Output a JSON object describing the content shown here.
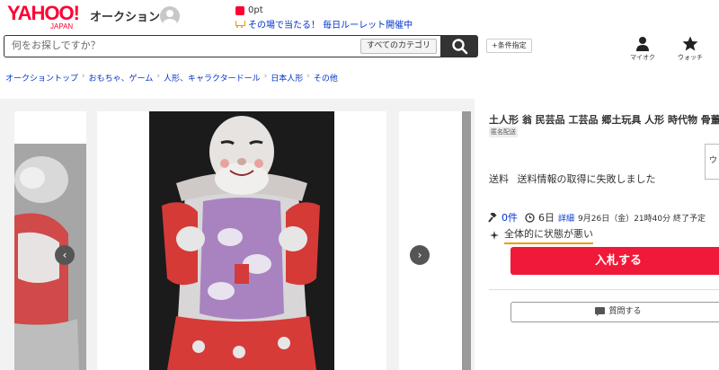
{
  "header": {
    "logo_text": "YAHOO!",
    "logo_sub": "JAPAN",
    "service_name": "オークション",
    "points": "0pt",
    "promo": "その場で当たる！ 毎日ルーレット開催中",
    "search_placeholder": "何をお探しですか？",
    "category_select": "すべてのカテゴリ",
    "condition_button": "+条件指定",
    "my_auction_label": "マイオク",
    "watch_label": "ウォッチ",
    "icons": [
      "search-icon",
      "person-icon",
      "star-icon",
      "cart-icon"
    ],
    "brand_color": "#ff0033"
  },
  "breadcrumb": [
    "オークショントップ",
    "おもちゃ、ゲーム",
    "人形、キャラクタードール",
    "日本人形",
    "その他"
  ],
  "gallery": {
    "prev_icon": "‹",
    "next_icon": "›"
  },
  "item": {
    "title": "土人形 翁 民芸品 工芸品 郷土玩具 人形 時代物 骨董",
    "anonymous_badge": "匿名配送",
    "side_panel_text": "ウ",
    "shipping_label": "送料",
    "shipping_value": "送料情報の取得に失敗しました",
    "bids": "0件",
    "days_left": "6日",
    "detail_link": "詳細",
    "end_time": "9月26日（金）21時40分 終了予定",
    "condition": "全体的に状態が悪い",
    "bid_button": "入札する",
    "question_button": "質問する",
    "accent_color": "#f0193a"
  }
}
